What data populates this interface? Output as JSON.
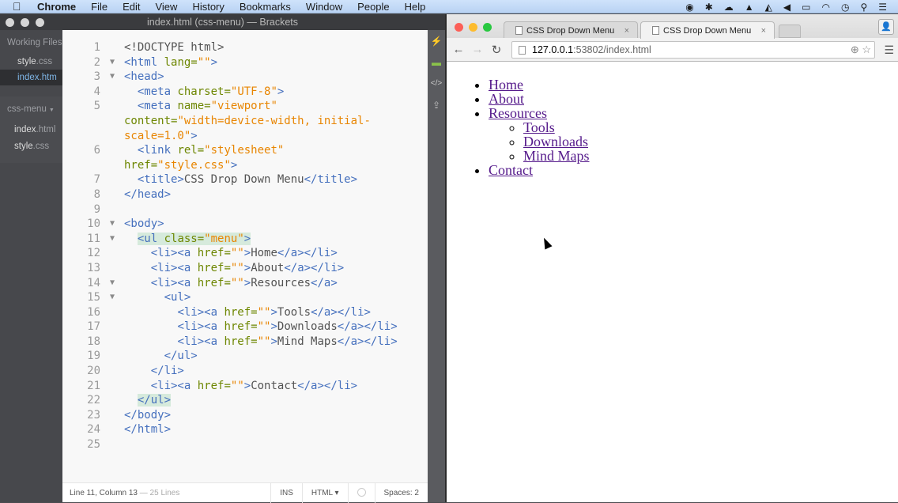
{
  "menubar": {
    "apple": "",
    "items": [
      "Chrome",
      "File",
      "Edit",
      "View",
      "History",
      "Bookmarks",
      "Window",
      "People",
      "Help"
    ],
    "status_icons": [
      "record-icon",
      "sparkle-icon",
      "creative-cloud-icon",
      "bell-icon",
      "drive-icon",
      "volume-icon",
      "battery-icon",
      "wifi-icon",
      "clock-icon",
      "spotlight-icon",
      "notification-list-icon"
    ]
  },
  "brackets": {
    "title": "index.html (css-menu) — Brackets",
    "sidebar": {
      "working_files_title": "Working Files",
      "working_files": [
        {
          "name": "style",
          "ext": ".css",
          "active": false
        },
        {
          "name": "index",
          "ext": ".htm",
          "active": true
        }
      ],
      "project_name": "css-menu",
      "project_files": [
        {
          "name": "index",
          "ext": ".html"
        },
        {
          "name": "style",
          "ext": ".css"
        }
      ]
    },
    "code_lines": [
      {
        "n": "1",
        "fold": "",
        "html": "<span class=\"plain\">&lt;!DOCTYPE html&gt;</span>"
      },
      {
        "n": "2",
        "fold": "▼",
        "html": "<span class=\"tag\">&lt;html</span> <span class=\"attr\">lang=</span><span class=\"str\">\"\"</span><span class=\"tag\">&gt;</span>"
      },
      {
        "n": "3",
        "fold": "▼",
        "html": "<span class=\"tag\">&lt;head&gt;</span>"
      },
      {
        "n": "4",
        "fold": "",
        "html": "  <span class=\"tag\">&lt;meta</span> <span class=\"attr\">charset=</span><span class=\"str\">\"UTF-8\"</span><span class=\"tag\">&gt;</span>"
      },
      {
        "n": "5",
        "fold": "",
        "html": "  <span class=\"tag\">&lt;meta</span> <span class=\"attr\">name=</span><span class=\"str\">\"viewport\"</span>"
      },
      {
        "n": "",
        "fold": "",
        "html": "<span class=\"attr\">content=</span><span class=\"str\">\"width=device-width, initial-</span>"
      },
      {
        "n": "",
        "fold": "",
        "html": "<span class=\"str\">scale=1.0\"</span><span class=\"tag\">&gt;</span>"
      },
      {
        "n": "6",
        "fold": "",
        "html": "  <span class=\"tag\">&lt;link</span> <span class=\"attr\">rel=</span><span class=\"str\">\"stylesheet\"</span>"
      },
      {
        "n": "",
        "fold": "",
        "html": "<span class=\"attr\">href=</span><span class=\"str\">\"style.css\"</span><span class=\"tag\">&gt;</span>"
      },
      {
        "n": "7",
        "fold": "",
        "html": "  <span class=\"tag\">&lt;title&gt;</span><span class=\"plain\">CSS Drop Down Menu</span><span class=\"tag\">&lt;/title&gt;</span>"
      },
      {
        "n": "8",
        "fold": "",
        "html": "<span class=\"tag\">&lt;/head&gt;</span>"
      },
      {
        "n": "9",
        "fold": "",
        "html": ""
      },
      {
        "n": "10",
        "fold": "▼",
        "html": "<span class=\"tag\">&lt;body&gt;</span>"
      },
      {
        "n": "11",
        "fold": "▼",
        "html": "  <span class=\"hl\"><span class=\"tag\">&lt;ul</span> <span class=\"attr\">class=</span><span class=\"str\">\"menu\"</span><span class=\"tag\">&gt;</span></span>"
      },
      {
        "n": "12",
        "fold": "",
        "html": "    <span class=\"tag\">&lt;li&gt;&lt;a</span> <span class=\"attr\">href=</span><span class=\"str\">\"\"</span><span class=\"tag\">&gt;</span><span class=\"plain\">Home</span><span class=\"tag\">&lt;/a&gt;&lt;/li&gt;</span>"
      },
      {
        "n": "13",
        "fold": "",
        "html": "    <span class=\"tag\">&lt;li&gt;&lt;a</span> <span class=\"attr\">href=</span><span class=\"str\">\"\"</span><span class=\"tag\">&gt;</span><span class=\"plain\">About</span><span class=\"tag\">&lt;/a&gt;&lt;/li&gt;</span>"
      },
      {
        "n": "14",
        "fold": "▼",
        "html": "    <span class=\"tag\">&lt;li&gt;&lt;a</span> <span class=\"attr\">href=</span><span class=\"str\">\"\"</span><span class=\"tag\">&gt;</span><span class=\"plain\">Resources</span><span class=\"tag\">&lt;/a&gt;</span>"
      },
      {
        "n": "15",
        "fold": "▼",
        "html": "      <span class=\"tag\">&lt;ul&gt;</span>"
      },
      {
        "n": "16",
        "fold": "",
        "html": "        <span class=\"tag\">&lt;li&gt;&lt;a</span> <span class=\"attr\">href=</span><span class=\"str\">\"\"</span><span class=\"tag\">&gt;</span><span class=\"plain\">Tools</span><span class=\"tag\">&lt;/a&gt;&lt;/li&gt;</span>"
      },
      {
        "n": "17",
        "fold": "",
        "html": "        <span class=\"tag\">&lt;li&gt;&lt;a</span> <span class=\"attr\">href=</span><span class=\"str\">\"\"</span><span class=\"tag\">&gt;</span><span class=\"plain\">Downloads</span><span class=\"tag\">&lt;/a&gt;&lt;/li&gt;</span>"
      },
      {
        "n": "18",
        "fold": "",
        "html": "        <span class=\"tag\">&lt;li&gt;&lt;a</span> <span class=\"attr\">href=</span><span class=\"str\">\"\"</span><span class=\"tag\">&gt;</span><span class=\"plain\">Mind Maps</span><span class=\"tag\">&lt;/a&gt;&lt;/li&gt;</span>"
      },
      {
        "n": "19",
        "fold": "",
        "html": "      <span class=\"tag\">&lt;/ul&gt;</span>"
      },
      {
        "n": "20",
        "fold": "",
        "html": "    <span class=\"tag\">&lt;/li&gt;</span>"
      },
      {
        "n": "21",
        "fold": "",
        "html": "    <span class=\"tag\">&lt;li&gt;&lt;a</span> <span class=\"attr\">href=</span><span class=\"str\">\"\"</span><span class=\"tag\">&gt;</span><span class=\"plain\">Contact</span><span class=\"tag\">&lt;/a&gt;&lt;/li&gt;</span>"
      },
      {
        "n": "22",
        "fold": "",
        "html": "  <span class=\"hl\"><span class=\"tag\">&lt;/ul&gt;</span></span>"
      },
      {
        "n": "23",
        "fold": "",
        "html": "<span class=\"tag\">&lt;/body&gt;</span>"
      },
      {
        "n": "24",
        "fold": "",
        "html": "<span class=\"tag\">&lt;/html&gt;</span>"
      },
      {
        "n": "25",
        "fold": "",
        "html": ""
      }
    ],
    "statusbar": {
      "position": "Line 11, Column 13",
      "lines": " — 25 Lines",
      "mode": "INS",
      "language": "HTML ▾",
      "spaces": "Spaces: 2"
    }
  },
  "chrome": {
    "tabs": [
      {
        "title": "CSS Drop Down Menu",
        "active": false
      },
      {
        "title": "CSS Drop Down Menu",
        "active": true
      }
    ],
    "close_glyph": "×",
    "url_host": "127.0.0.1",
    "url_rest": ":53802/index.html",
    "page": {
      "menu": [
        {
          "label": "Home"
        },
        {
          "label": "About"
        },
        {
          "label": "Resources",
          "children": [
            "Tools",
            "Downloads",
            "Mind Maps"
          ]
        },
        {
          "label": "Contact"
        }
      ]
    }
  }
}
